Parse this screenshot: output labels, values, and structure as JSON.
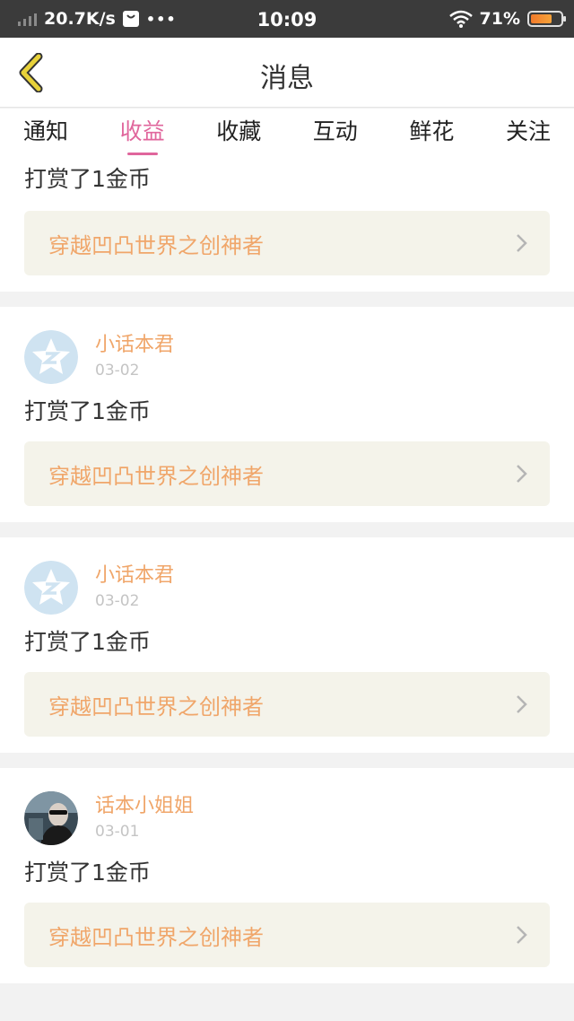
{
  "status_bar": {
    "net_speed": "20.7K/s",
    "dots": "•••",
    "time": "10:09",
    "battery": "71%",
    "battery_level": 0.71
  },
  "header": {
    "title": "消息",
    "back_icon": "chevron-left-icon"
  },
  "tabs": [
    {
      "label": "通知",
      "active": false
    },
    {
      "label": "收益",
      "active": true
    },
    {
      "label": "收藏",
      "active": false
    },
    {
      "label": "互动",
      "active": false
    },
    {
      "label": "鲜花",
      "active": false
    },
    {
      "label": "关注",
      "active": false
    }
  ],
  "partial_card": {
    "message": "打赏了1金币",
    "book_title": "穿越凹凸世界之创神者"
  },
  "cards": [
    {
      "username": "小话本君",
      "date": "03-02",
      "message": "打赏了1金币",
      "book_title": "穿越凹凸世界之创神者",
      "avatar": "default-star-avatar"
    },
    {
      "username": "小话本君",
      "date": "03-02",
      "message": "打赏了1金币",
      "book_title": "穿越凹凸世界之创神者",
      "avatar": "default-star-avatar"
    },
    {
      "username": "话本小姐姐",
      "date": "03-01",
      "message": "打赏了1金币",
      "book_title": "穿越凹凸世界之创神者",
      "avatar": "photo-avatar"
    }
  ],
  "colors": {
    "accent_pink": "#e0669c",
    "accent_orange": "#f0a66a",
    "link_bg": "#f4f3ea",
    "status_bar_bg": "#3b3b3b",
    "back_icon": "#e8d23a"
  }
}
